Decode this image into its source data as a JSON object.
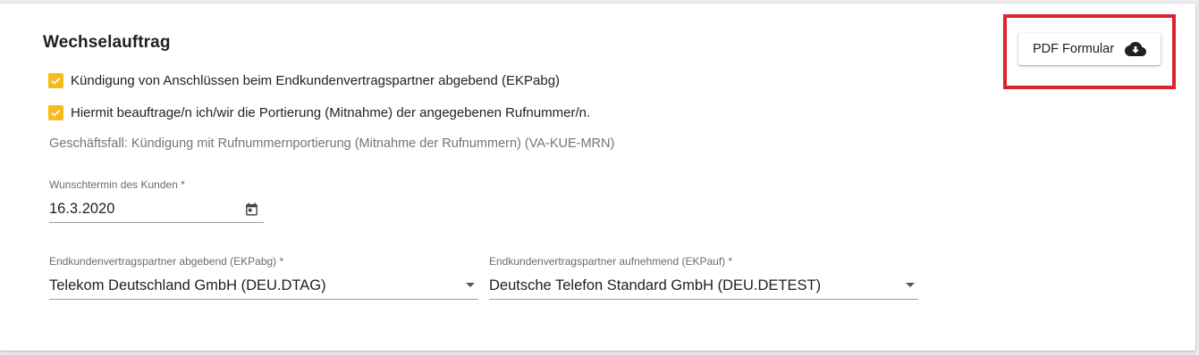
{
  "form": {
    "title": "Wechselauftrag",
    "checkboxes": [
      {
        "label": "Kündigung von Anschlüssen beim Endkundenvertragspartner abgebend (EKPabg)",
        "checked": true
      },
      {
        "label": "Hiermit beauftrage/n ich/wir die Portierung (Mitnahme) der angegebenen Rufnummer/n.",
        "checked": true
      }
    ],
    "business_case": "Geschäftsfall: Kündigung mit Rufnummernportierung (Mitnahme der Rufnummern) (VA-KUE-MRN)",
    "date_field": {
      "label": "Wunschtermin des Kunden *",
      "value": "16.3.2020",
      "icon": "calendar-icon"
    },
    "giving_partner": {
      "label": "Endkundenvertragspartner abgebend (EKPabg) *",
      "value": "Telekom Deutschland GmbH (DEU.DTAG)"
    },
    "receiving_partner": {
      "label": "Endkundenvertragspartner aufnehmend (EKPauf) *",
      "value": "Deutsche Telefon Standard GmbH (DEU.DETEST)"
    }
  },
  "pdf_button": {
    "label": "PDF Formular",
    "icon": "cloud-download-icon"
  },
  "colors": {
    "checkbox_fill": "#f5bc1c",
    "highlight_border": "#d9262c"
  }
}
